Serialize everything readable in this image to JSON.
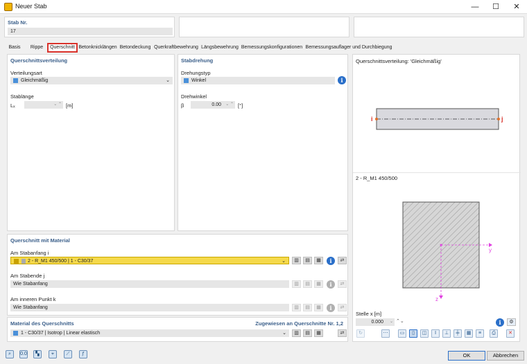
{
  "window": {
    "title": "Neuer Stab",
    "minimize": "—",
    "maximize": "☐",
    "close": "✕"
  },
  "stab_nr": {
    "label": "Stab Nr.",
    "value": "17"
  },
  "tabs": [
    "Basis",
    "Rippe",
    "Querschnitt",
    "Betonknicklängen",
    "Betondeckung",
    "Querkraftbewehrung",
    "Längsbewehrung",
    "Bemessungskonfigurationen",
    "Bemessungsauflager und Durchbiegung"
  ],
  "active_tab": "Querschnitt",
  "querschnittsverteilung": {
    "header": "Querschnittsverteilung",
    "verteilungsart_label": "Verteilungsart",
    "verteilungsart_value": "Gleichmäßig",
    "stablaenge_label": "Stablänge",
    "lx_symbol": "Lₓ",
    "lx_unit": "[m]"
  },
  "stabdrehung": {
    "header": "Stabdrehung",
    "drehungstyp_label": "Drehungstyp",
    "drehungstyp_value": "Winkel",
    "drehwinkel_label": "Drehwinkel",
    "beta_symbol": "β",
    "beta_value": "0.00",
    "beta_unit": "[°]"
  },
  "querschnitt_mit_material": {
    "header": "Querschnitt mit Material",
    "anfang_label": "Am Stabanfang i",
    "anfang_value": "2 - R_M1 450/500 | 1 - C30/37",
    "ende_label": "Am Stabende j",
    "ende_value": "Wie Stabanfang",
    "innen_label": "Am inneren Punkt k",
    "innen_value": "Wie Stabanfang"
  },
  "material": {
    "header": "Material des Querschnitts",
    "assigned": "Zugewiesen an Querschnitte Nr. 1,2",
    "value": "1 - C30/37 | Isotrop | Linear elastisch"
  },
  "preview": {
    "distribution_title": "Querschnittsverteilung: 'Gleichmäßig'",
    "node_i": "i",
    "node_j": "j",
    "section_title": "2 - R_M1 450/500",
    "axis_y": "y",
    "axis_z": "z",
    "stelle_label": "Stelle x [m]",
    "stelle_value": "0.000"
  },
  "buttons": {
    "ok": "OK",
    "cancel": "Abbrechen"
  },
  "colors": {
    "accent": "#3b5f8a",
    "highlight": "#f5d94a",
    "active_tab_border": "#d9322b",
    "axis": "#e040e0"
  }
}
